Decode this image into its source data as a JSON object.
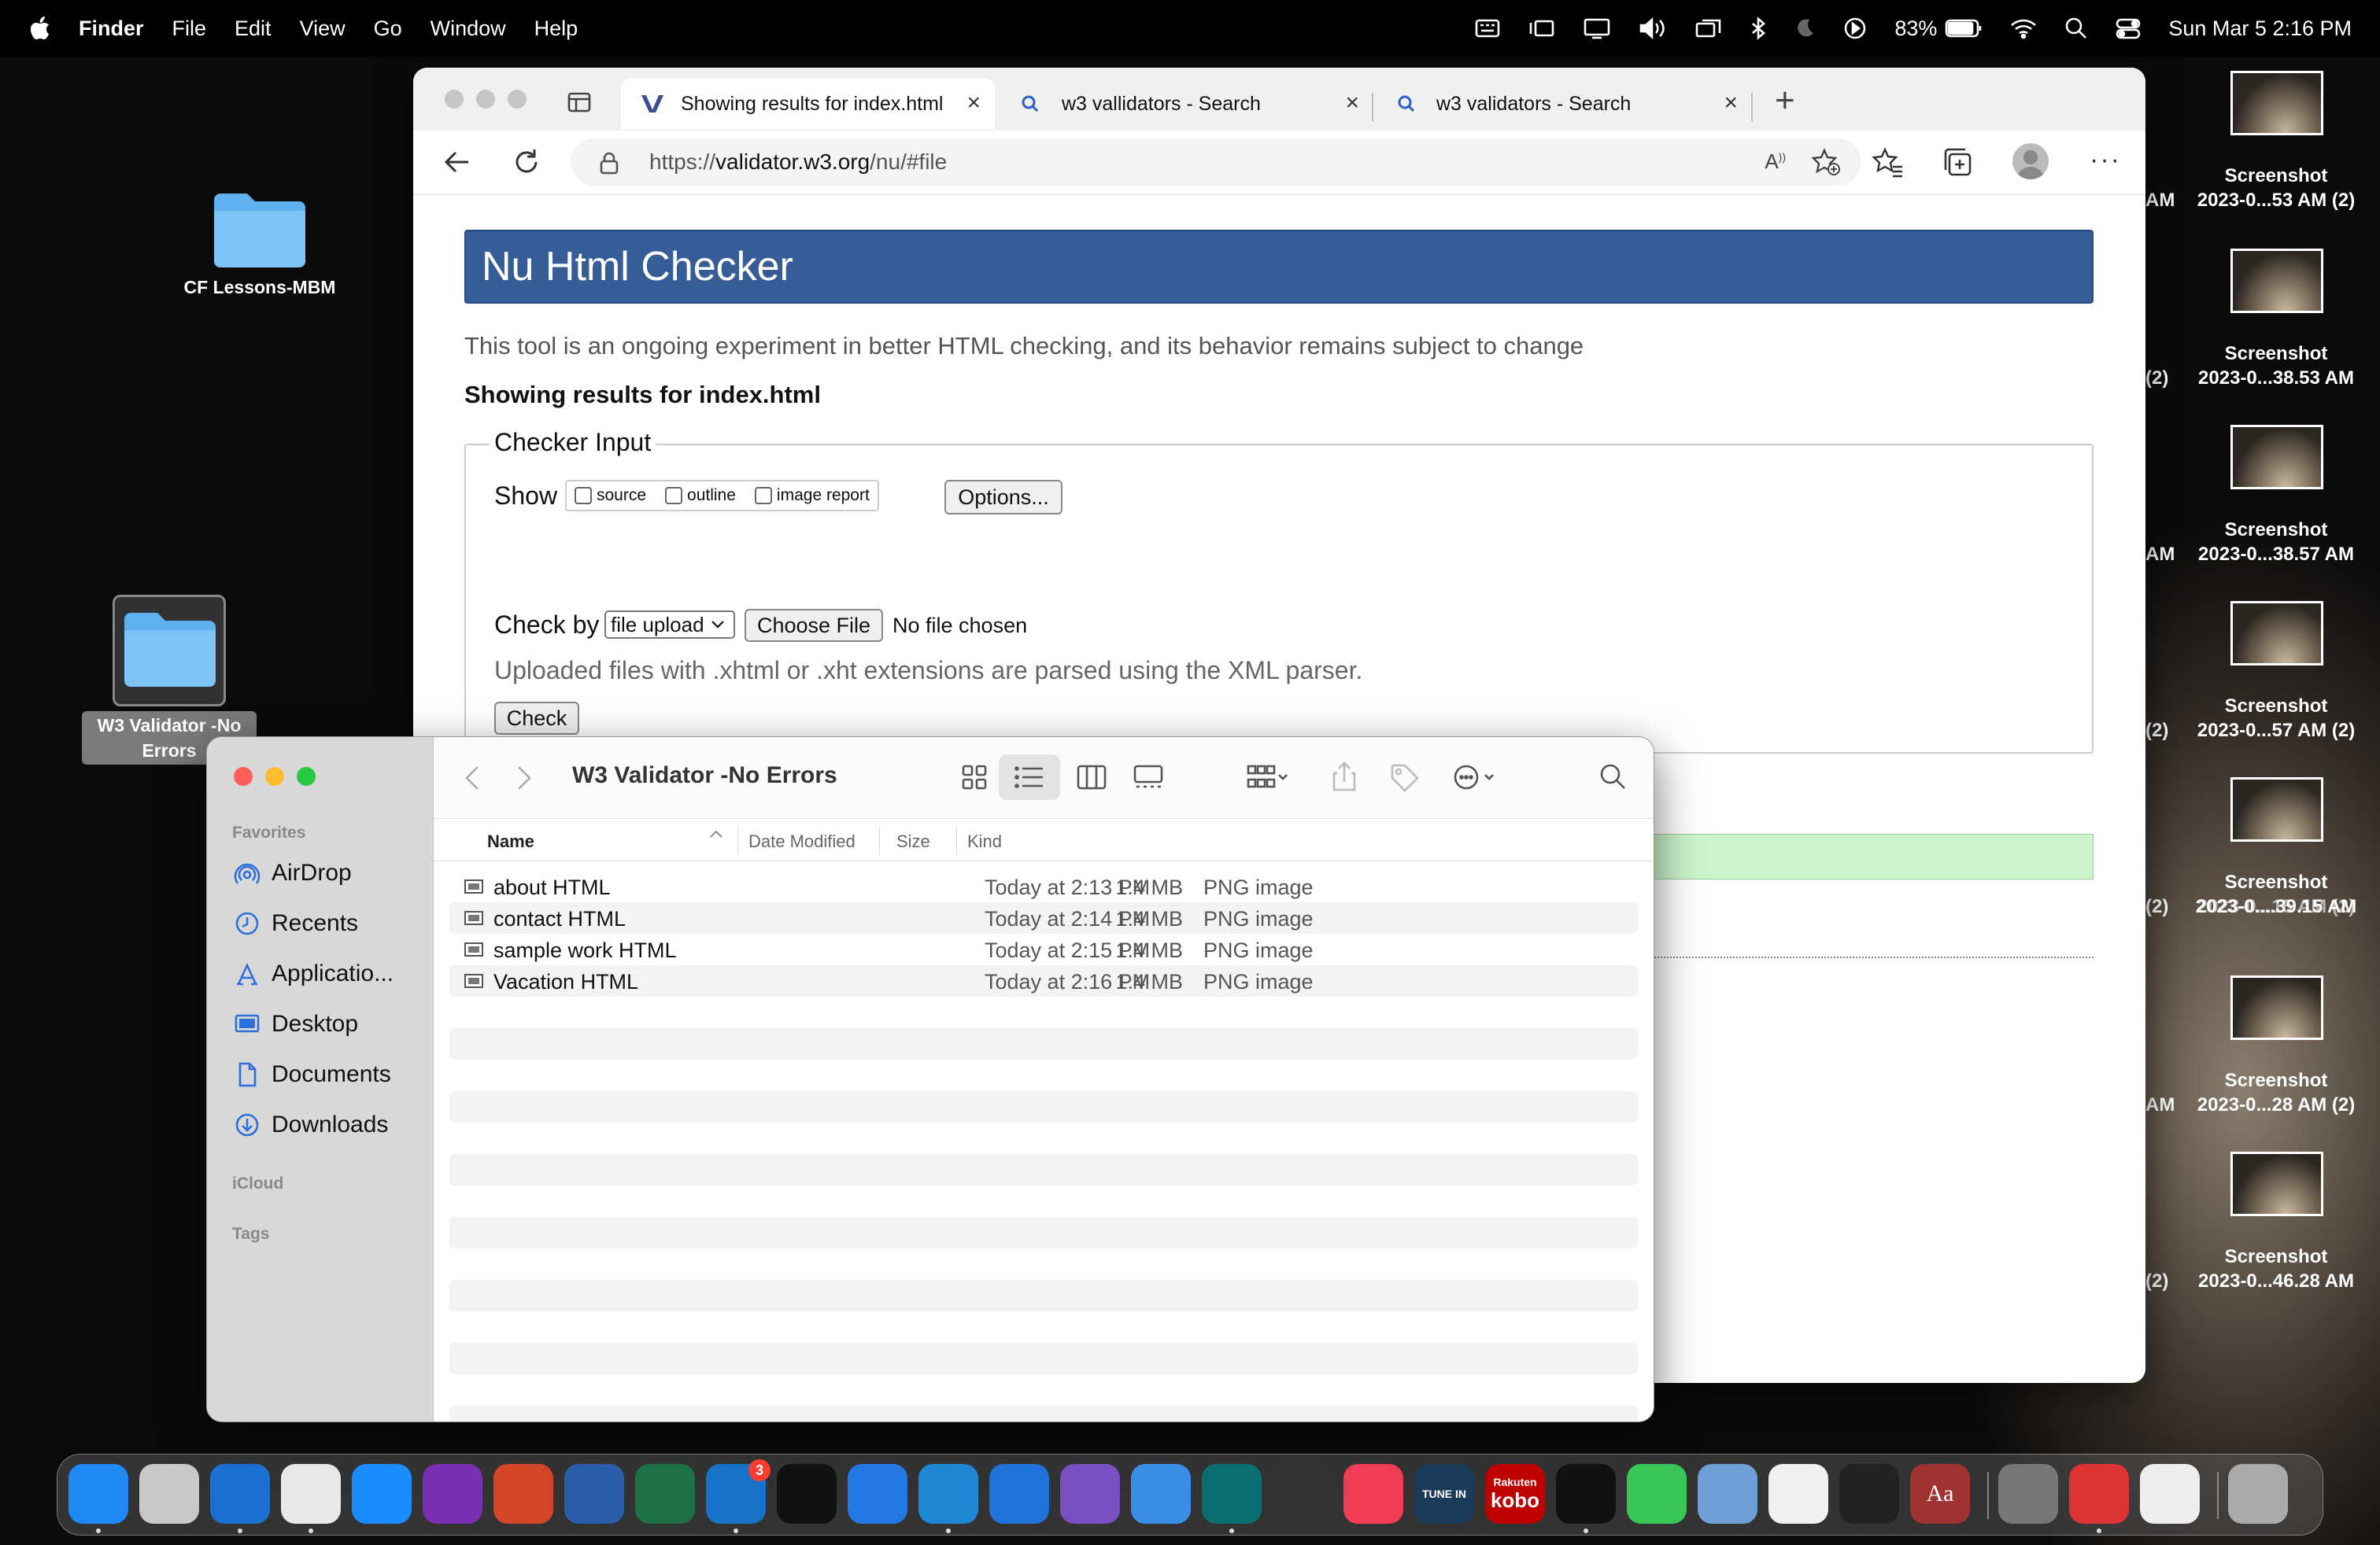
{
  "menubar": {
    "app": "Finder",
    "items": [
      "File",
      "Edit",
      "View",
      "Go",
      "Window",
      "Help"
    ],
    "battery": "83%",
    "datetime": "Sun Mar 5  2:16 PM"
  },
  "desktop": {
    "folders": [
      {
        "label": "CF Lessons-MBM"
      },
      {
        "label_line1": "W3 Validator -No",
        "label_line2": "Errors"
      }
    ],
    "screenshots": [
      {
        "line1": "Screenshot",
        "line2": "2023-0...53 AM (2)",
        "left_fragment": "AM"
      },
      {
        "line1": "Screenshot",
        "line2": "2023-0...38.53 AM",
        "left_fragment": "(2)"
      },
      {
        "line1": "Screenshot",
        "line2": "2023-0...38.57 AM",
        "left_fragment": "AM"
      },
      {
        "line1": "Screenshot",
        "line2": "2023-0...57 AM (2)",
        "left_fragment": "(2)"
      },
      {
        "line1": "Screenshot",
        "line2": "2023-0....39.15 AM",
        "left_fragment": "(2)",
        "overlap": "2023-0...15 AM (2)"
      },
      {
        "line1": "Screenshot",
        "line2": "2023-0...28 AM (2)",
        "left_fragment": "AM"
      },
      {
        "line1": "Screenshot",
        "line2": "2023-0...46.28 AM",
        "left_fragment": "(2)"
      }
    ]
  },
  "browser": {
    "tabs": [
      {
        "label": "Showing results for index.html",
        "icon": "w3-validator-icon"
      },
      {
        "label": "w3 vallidators - Search",
        "icon": "search-icon"
      },
      {
        "label": "w3 validators - Search",
        "icon": "search-icon"
      }
    ],
    "url_prefix": "https://",
    "url_domain": "validator.w3.org",
    "url_path": "/nu/#file",
    "page": {
      "header": "Nu Html Checker",
      "intro": "This tool is an ongoing experiment in better HTML checking, and its behavior remains subject to change",
      "showing": "Showing results for index.html",
      "legend": "Checker Input",
      "show_label": "Show",
      "show_options": [
        "source",
        "outline",
        "image report"
      ],
      "options_button": "Options...",
      "check_by_label": "Check by",
      "check_by_value": "file upload",
      "choose_file": "Choose File",
      "no_file": "No file chosen",
      "note": "Uploaded files with .xhtml or .xht extensions are parsed using the XML parser.",
      "check_button": "Check"
    }
  },
  "finder": {
    "title": "W3 Validator -No Errors",
    "sidebar": {
      "favorites_head": "Favorites",
      "items": [
        "AirDrop",
        "Recents",
        "Applicatio...",
        "Desktop",
        "Documents",
        "Downloads"
      ],
      "icloud_head": "iCloud",
      "tags_head": "Tags"
    },
    "columns": {
      "name": "Name",
      "modified": "Date Modified",
      "size": "Size",
      "kind": "Kind"
    },
    "files": [
      {
        "name": "about HTML",
        "modified": "Today at 2:13 PM",
        "size": "1.4 MB",
        "kind": "PNG image"
      },
      {
        "name": "contact HTML",
        "modified": "Today at 2:14 PM",
        "size": "1.4 MB",
        "kind": "PNG image"
      },
      {
        "name": "sample work HTML",
        "modified": "Today at 2:15 PM",
        "size": "1.4 MB",
        "kind": "PNG image"
      },
      {
        "name": "Vacation HTML",
        "modified": "Today at 2:16 PM",
        "size": "1.4 MB",
        "kind": "PNG image"
      }
    ]
  },
  "dock": {
    "outlook_badge": "3",
    "tunein_label": "TUNE IN",
    "kobo_line1": "Rakuten",
    "kobo_line2": "kobo",
    "dictionary_label": "Aa"
  },
  "colors": {
    "nu_header": "#365d95",
    "finder_accent": "#2f6fd9",
    "close": "#ff5f57",
    "minimize": "#febc2e",
    "zoom": "#28c840"
  }
}
